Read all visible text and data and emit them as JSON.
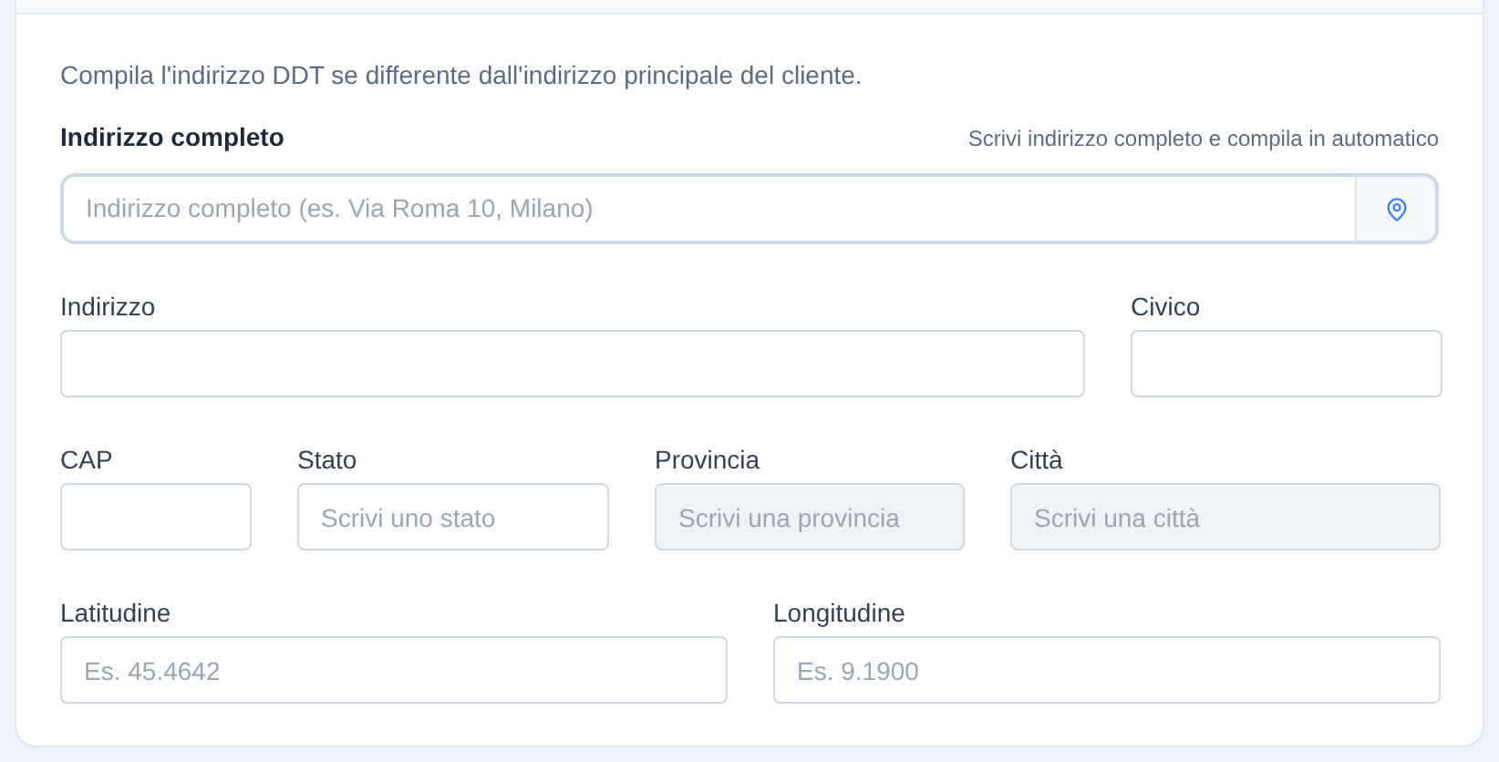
{
  "description": "Compila l'indirizzo DDT se differente dall'indirizzo principale del cliente.",
  "full_address": {
    "label": "Indirizzo completo",
    "hint": "Scrivi indirizzo completo e compila in automatico",
    "placeholder": "Indirizzo completo (es. Via Roma 10, Milano)"
  },
  "rows": [
    [
      {
        "label": "Indirizzo",
        "disabled": false
      },
      {
        "label": "Civico",
        "disabled": false
      }
    ],
    [
      {
        "label": "CAP",
        "disabled": false
      },
      {
        "label": "Stato",
        "placeholder": "Scrivi uno stato",
        "disabled": false
      },
      {
        "label": "Provincia",
        "placeholder": "Scrivi una provincia",
        "disabled": true
      },
      {
        "label": "Città",
        "placeholder": "Scrivi una città",
        "disabled": true
      }
    ],
    [
      {
        "label": "Latitudine",
        "placeholder": "Es. 45.4642",
        "disabled": false
      },
      {
        "label": "Longitudine",
        "placeholder": "Es. 9.1900",
        "disabled": false
      }
    ]
  ]
}
